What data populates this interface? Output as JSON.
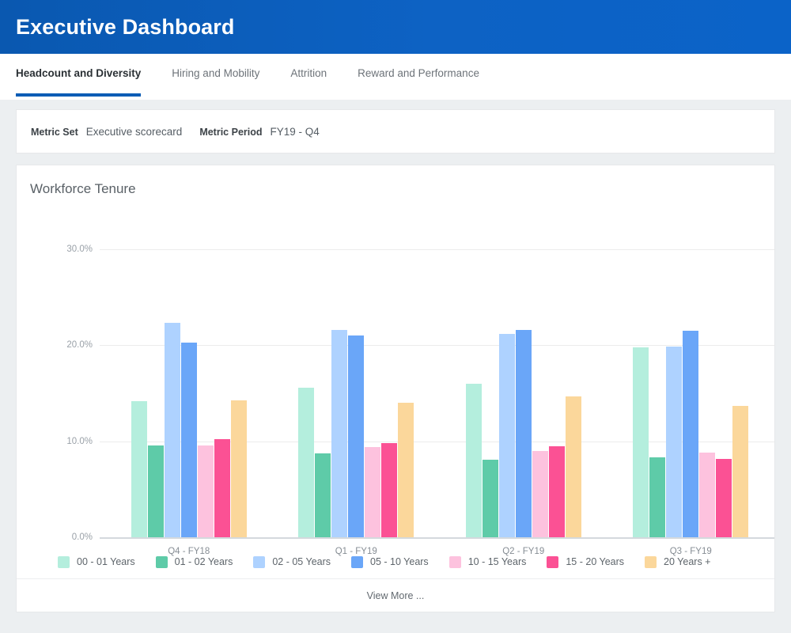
{
  "header": {
    "title": "Executive Dashboard",
    "background": "#0b60c2"
  },
  "tabs": [
    {
      "label": "Headcount and Diversity",
      "active": true
    },
    {
      "label": "Hiring and Mobility",
      "active": false
    },
    {
      "label": "Attrition",
      "active": false
    },
    {
      "label": "Reward and Performance",
      "active": false
    }
  ],
  "tab_accent": "#0b5cb5",
  "filters": [
    {
      "label": "Metric Set",
      "value": "Executive scorecard"
    },
    {
      "label": "Metric Period",
      "value": "FY19 - Q4"
    }
  ],
  "card": {
    "title": "Workforce Tenure",
    "footer_label": "View More ..."
  },
  "chart_data": {
    "type": "bar",
    "title": "Workforce Tenure",
    "xlabel": "",
    "ylabel": "",
    "ylim": [
      0,
      30
    ],
    "ytick_labels": [
      "0.0%",
      "10.0%",
      "20.0%",
      "30.0%"
    ],
    "yticks": [
      0,
      10,
      20,
      30
    ],
    "grid": true,
    "legend_position": "bottom",
    "categories": [
      "Q4 - FY18",
      "Q1 - FY19",
      "Q2 - FY19",
      "Q3 - FY19"
    ],
    "series": [
      {
        "name": "00 - 01 Years",
        "color": "#b4eedd",
        "values": [
          14.2,
          15.6,
          16.0,
          19.8
        ]
      },
      {
        "name": "01 - 02 Years",
        "color": "#5ecba8",
        "values": [
          9.6,
          8.7,
          8.1,
          8.3
        ]
      },
      {
        "name": "02 - 05 Years",
        "color": "#aed2ff",
        "values": [
          22.3,
          21.6,
          21.2,
          19.9
        ]
      },
      {
        "name": "05 - 10 Years",
        "color": "#6aa6f8",
        "values": [
          20.3,
          21.0,
          21.6,
          21.5
        ]
      },
      {
        "name": "10 - 15 Years",
        "color": "#fdc2de",
        "values": [
          9.6,
          9.4,
          9.0,
          8.8
        ]
      },
      {
        "name": "15 - 20 Years",
        "color": "#fb5194",
        "values": [
          10.2,
          9.8,
          9.5,
          8.2
        ]
      },
      {
        "name": "20 Years +",
        "color": "#fbd79b",
        "values": [
          14.3,
          14.0,
          14.7,
          13.7
        ]
      }
    ]
  }
}
